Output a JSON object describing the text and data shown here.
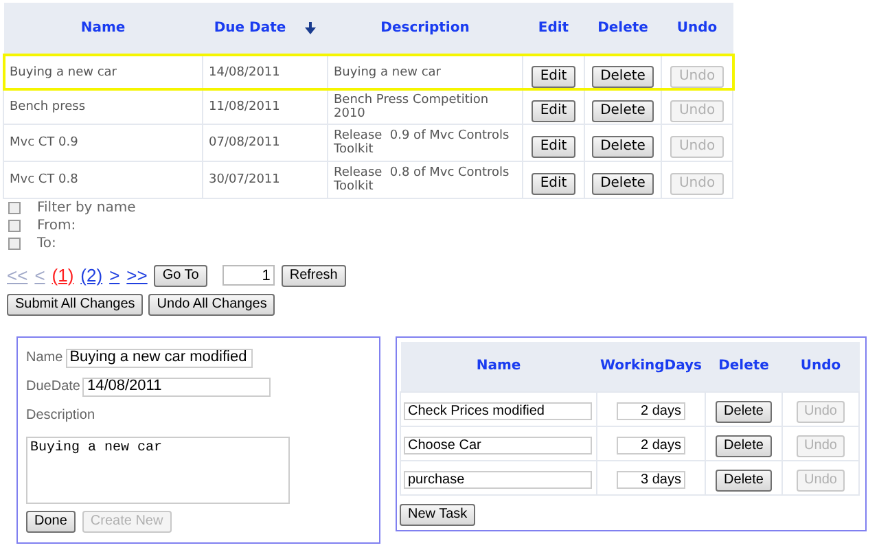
{
  "tasks_table": {
    "columns": [
      {
        "label": "Name",
        "sorted": false
      },
      {
        "label": "Due Date",
        "sorted": true
      },
      {
        "label": "Description",
        "sorted": false
      },
      {
        "label": "Edit",
        "sorted": false
      },
      {
        "label": "Delete",
        "sorted": false
      },
      {
        "label": "Undo",
        "sorted": false
      }
    ],
    "rows": [
      {
        "name": "Buying a new car",
        "due_date": "14/08/2011",
        "description": "Buying a new car",
        "edit": "Edit",
        "delete": "Delete",
        "undo": "Undo",
        "undo_disabled": true,
        "selected": true
      },
      {
        "name": "Bench press",
        "due_date": "11/08/2011",
        "description": "Bench Press Competition 2010",
        "edit": "Edit",
        "delete": "Delete",
        "undo": "Undo",
        "undo_disabled": true,
        "selected": false
      },
      {
        "name": "Mvc CT 0.9",
        "due_date": "07/08/2011",
        "description": "Release  0.9 of Mvc Controls Toolkit",
        "edit": "Edit",
        "delete": "Delete",
        "undo": "Undo",
        "undo_disabled": true,
        "selected": false
      },
      {
        "name": "Mvc CT 0.8",
        "due_date": "30/07/2011",
        "description": "Release  0.8 of Mvc Controls Toolkit",
        "edit": "Edit",
        "delete": "Delete",
        "undo": "Undo",
        "undo_disabled": true,
        "selected": false
      }
    ]
  },
  "filters": [
    {
      "label": "Filter by name",
      "checked": false
    },
    {
      "label": "From:",
      "checked": false
    },
    {
      "label": "To:",
      "checked": false
    }
  ],
  "pager": {
    "links": [
      {
        "label": "<<",
        "disabled": true,
        "selected": false
      },
      {
        "label": "<",
        "disabled": true,
        "selected": false
      },
      {
        "label": "(1)",
        "disabled": false,
        "selected": true
      },
      {
        "label": "(2)",
        "disabled": false,
        "selected": false
      },
      {
        "label": ">",
        "disabled": false,
        "selected": false
      },
      {
        "label": ">>",
        "disabled": false,
        "selected": false
      }
    ],
    "goto_button": "Go To",
    "page_value": "1",
    "refresh_button": "Refresh"
  },
  "actions": [
    "Submit All Changes",
    "Undo All Changes"
  ],
  "edit_form": {
    "name_label": "Name",
    "name_value": "Buying a new car modified",
    "due_label": "DueDate",
    "due_value": "14/08/2011",
    "description_label": "Description",
    "description_value": "Buying a new car",
    "buttons": [
      {
        "label": "Done",
        "disabled": false
      },
      {
        "label": "Create New",
        "disabled": true
      }
    ]
  },
  "subtasks_table": {
    "columns": [
      "Name",
      "WorkingDays",
      "Delete",
      "Undo"
    ],
    "rows": [
      {
        "name": "Check Prices modified",
        "working_days": "2 days",
        "delete": "Delete",
        "undo": "Undo",
        "undo_disabled": true
      },
      {
        "name": "Choose Car",
        "working_days": "2 days",
        "delete": "Delete",
        "undo": "Undo",
        "undo_disabled": true
      },
      {
        "name": "purchase",
        "working_days": "3 days",
        "delete": "Delete",
        "undo": "Undo",
        "undo_disabled": true
      }
    ],
    "new_button": "New Task"
  }
}
